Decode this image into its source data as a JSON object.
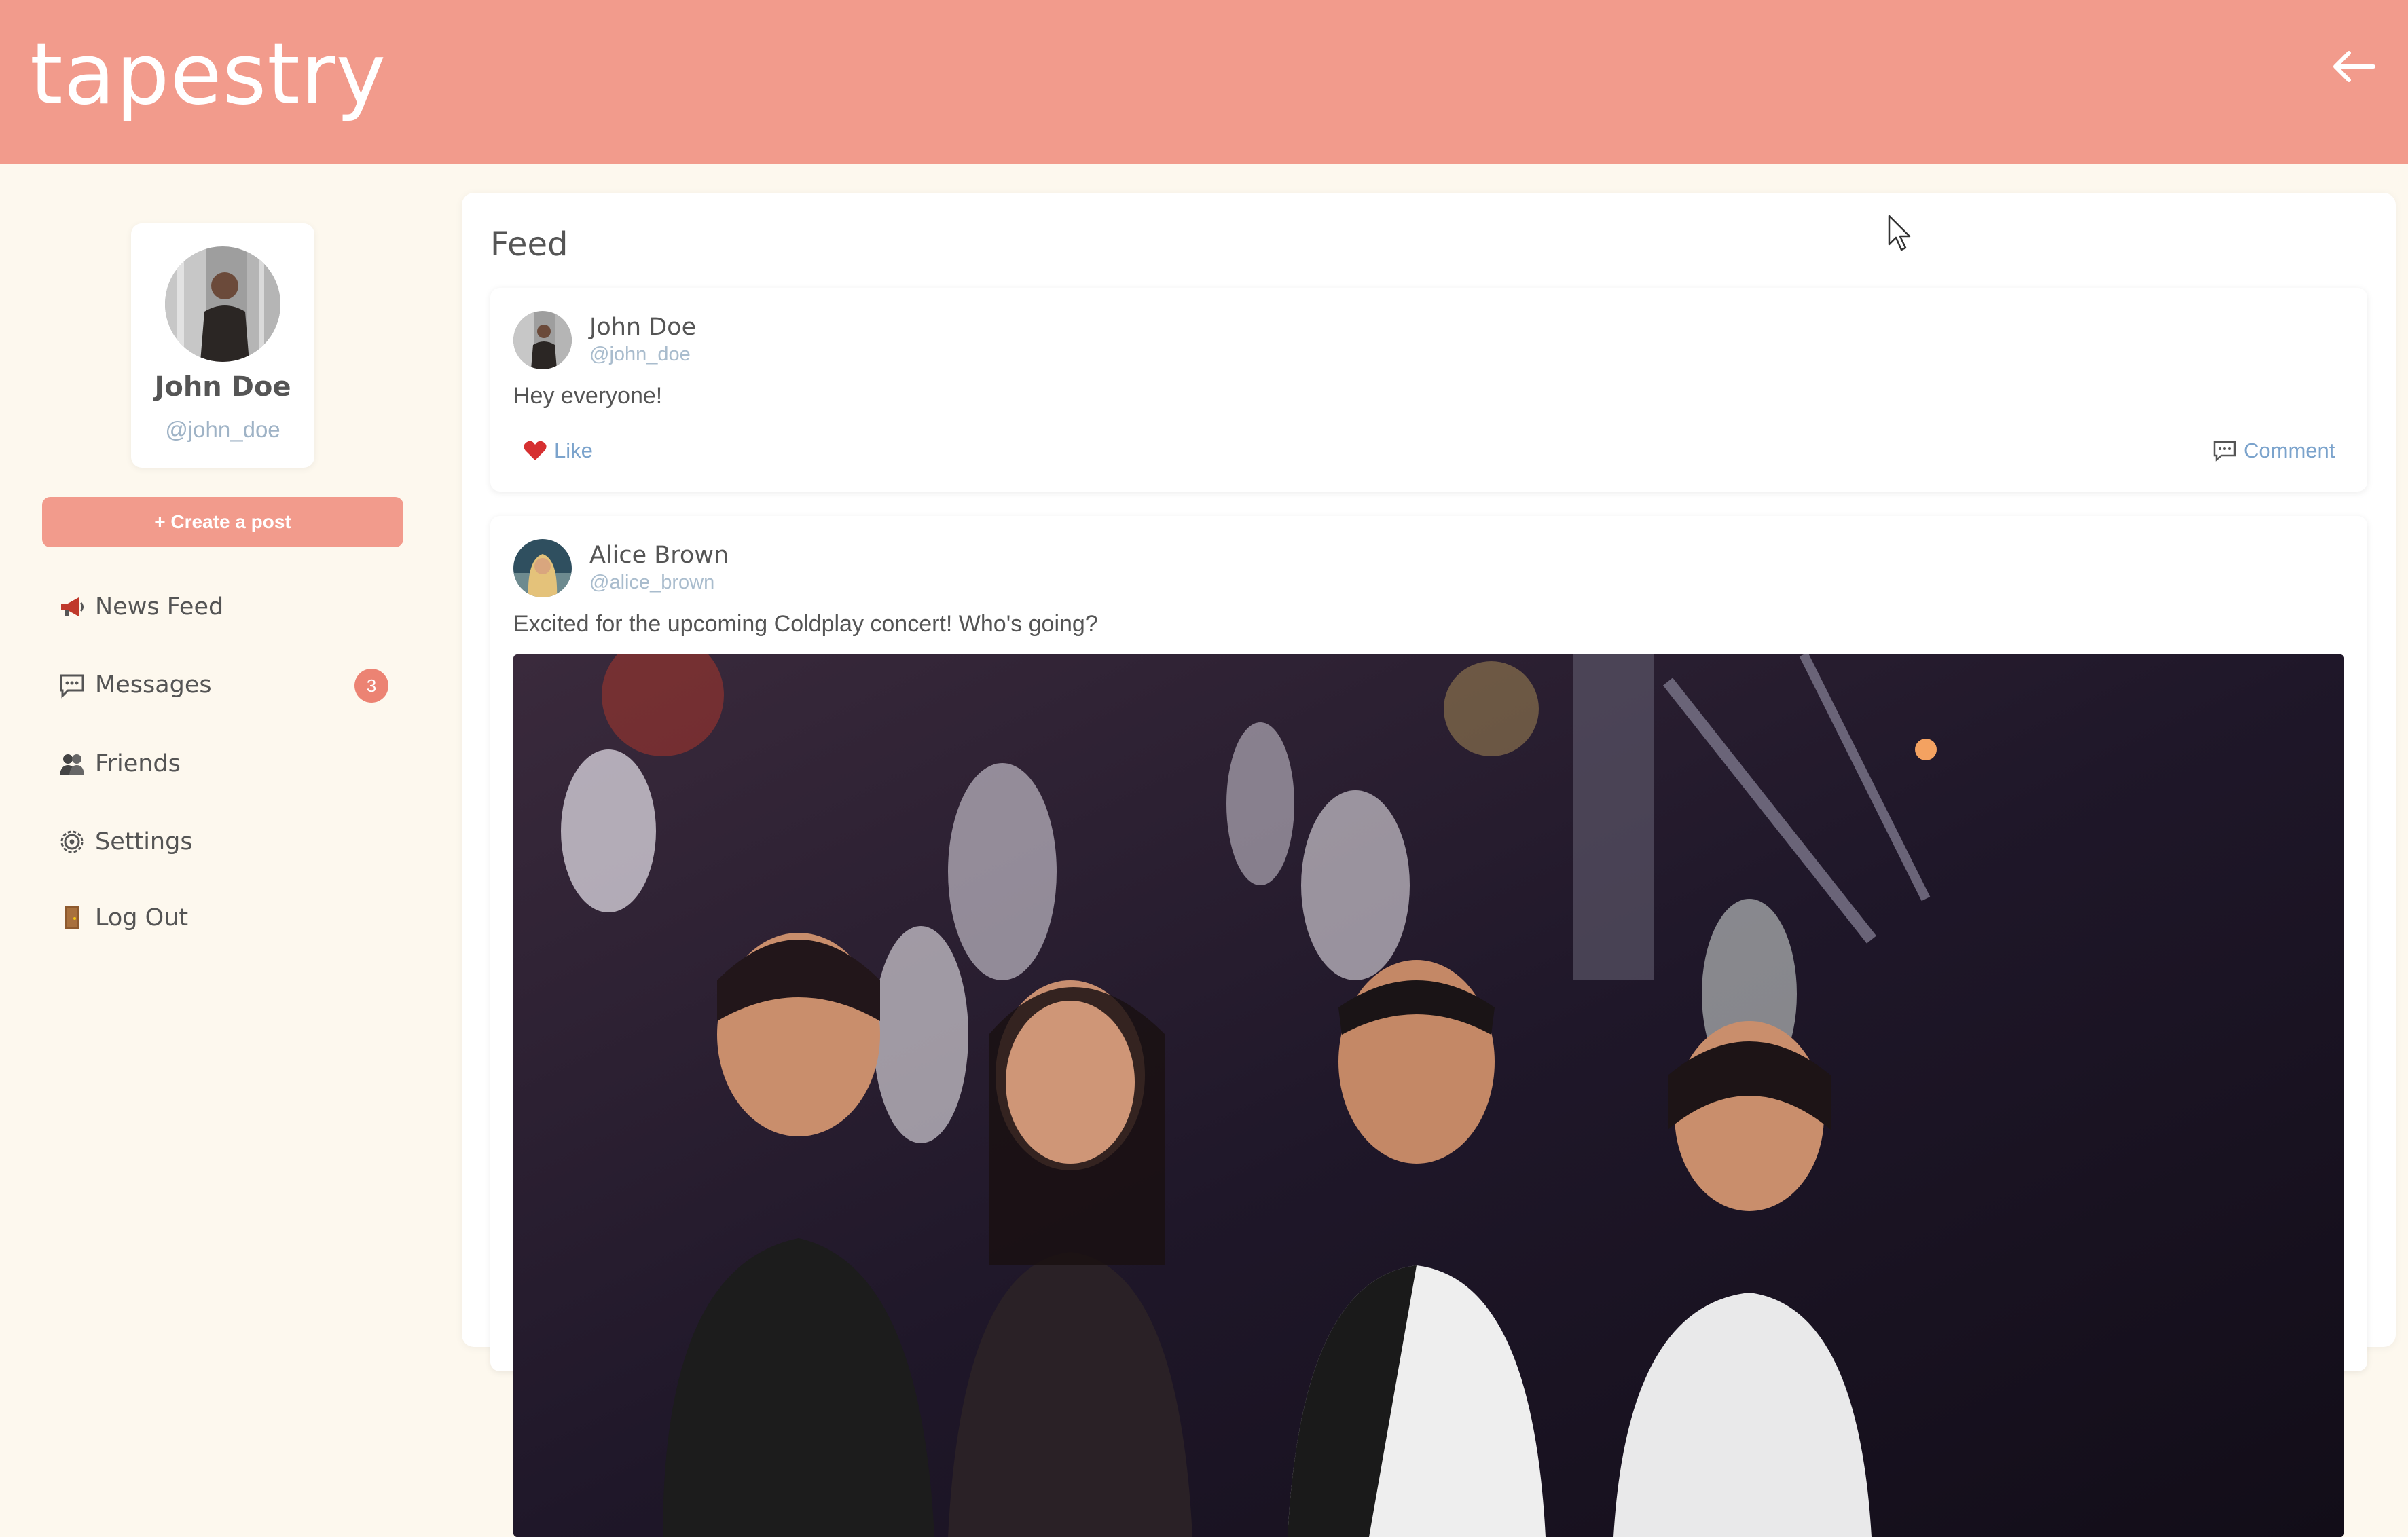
{
  "app": {
    "brand": "tapestry"
  },
  "header": {
    "back_icon": "arrow-left-icon"
  },
  "profile": {
    "name": "John Doe",
    "handle": "@john_doe"
  },
  "sidebar": {
    "create_post_label": "+ Create a post",
    "items": [
      {
        "label": "News Feed",
        "icon": "megaphone-icon"
      },
      {
        "label": "Messages",
        "icon": "speech-bubble-icon",
        "badge": "3"
      },
      {
        "label": "Friends",
        "icon": "people-icon"
      },
      {
        "label": "Settings",
        "icon": "gear-icon"
      },
      {
        "label": "Log Out",
        "icon": "door-icon"
      }
    ]
  },
  "feed": {
    "title": "Feed",
    "posts": [
      {
        "author": "John Doe",
        "handle": "@john_doe",
        "text": "Hey everyone!",
        "like_label": "Like",
        "comment_label": "Comment"
      },
      {
        "author": "Alice Brown",
        "handle": "@alice_brown",
        "text": "Excited for the upcoming Coldplay concert! Who's going?"
      }
    ]
  },
  "colors": {
    "accent": "#f29b8c",
    "background": "#fdf8ee",
    "badge": "#ec8373",
    "link": "#7ba3cc"
  }
}
